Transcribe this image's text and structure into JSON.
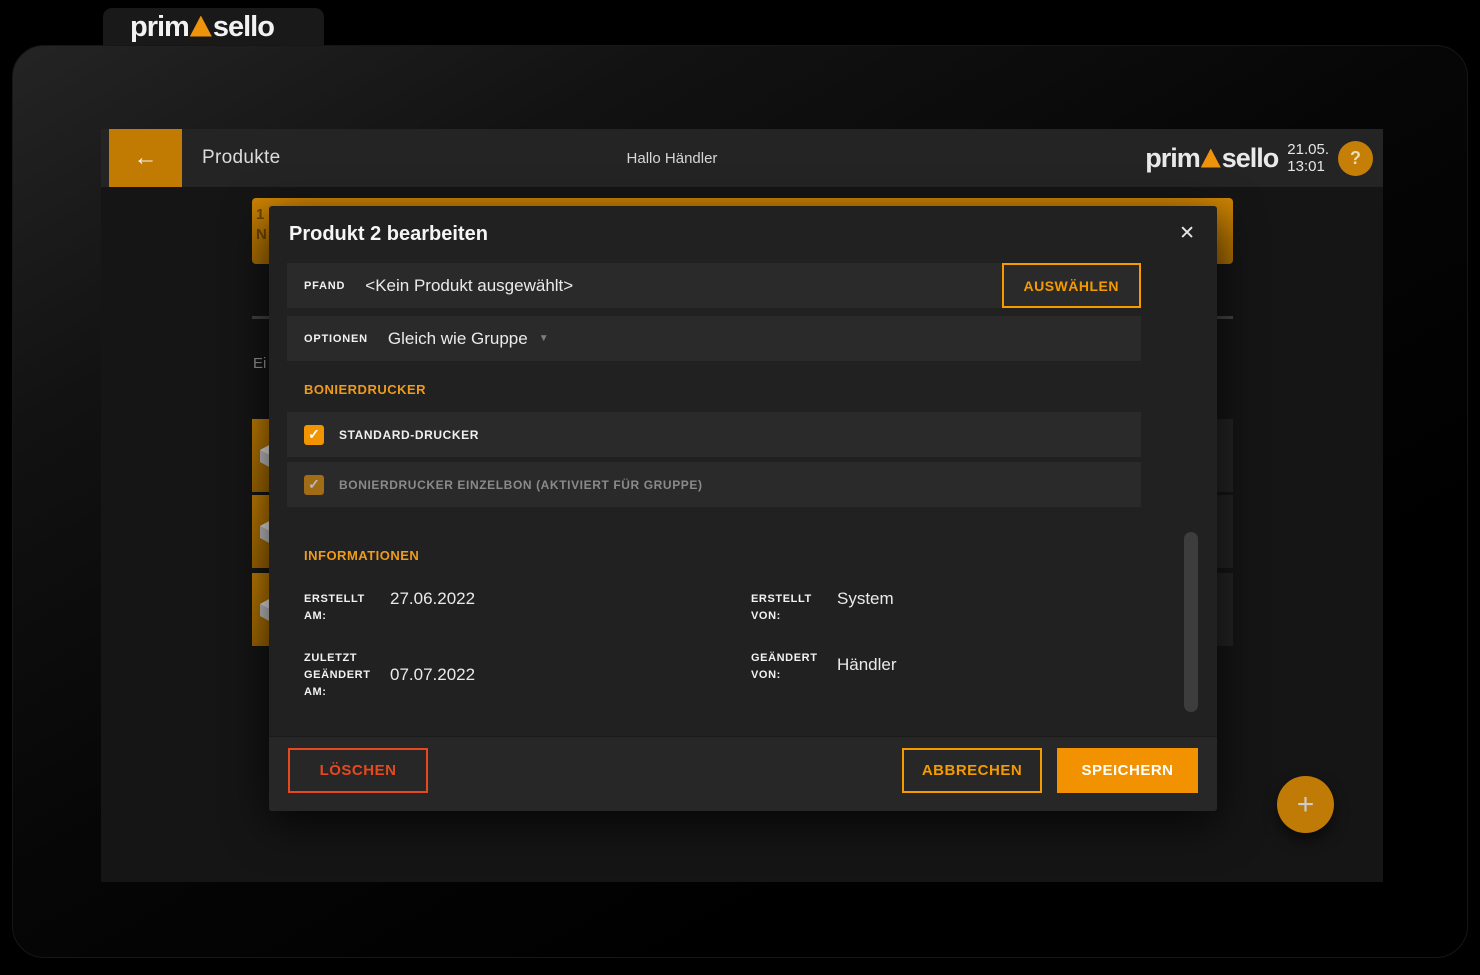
{
  "logo": {
    "prefix": "prim",
    "suffix": "sello"
  },
  "header": {
    "back_icon": "←",
    "title": "Produkte",
    "greeting": "Hallo Händler",
    "date": "21.05.",
    "time": "13:01",
    "help_label": "?"
  },
  "background_page": {
    "group_banner_fragment": "1\nN",
    "tab_fragment": "Ei",
    "product_row_count": 3
  },
  "modal": {
    "title": "Produkt 2 bearbeiten",
    "close_icon": "✕",
    "pfand": {
      "label": "PFAND",
      "value": "<Kein Produkt ausgewählt>",
      "button": "AUSWÄHLEN"
    },
    "optionen": {
      "label": "OPTIONEN",
      "value": "Gleich wie Gruppe",
      "caret_icon": "▼"
    },
    "bonierdrucker": {
      "title": "BONIERDRUCKER",
      "checkboxes": [
        {
          "label": "STANDARD-DRUCKER",
          "checked": true,
          "disabled": false,
          "check_icon": "✓"
        },
        {
          "label": "BONIERDRUCKER EINZELBON (AKTIVIERT FÜR GRUPPE)",
          "checked": true,
          "disabled": true,
          "check_icon": "✓"
        }
      ]
    },
    "informationen": {
      "title": "INFORMATIONEN",
      "items": [
        {
          "label": "ERSTELLT AM:",
          "value": "27.06.2022"
        },
        {
          "label": "ERSTELLT VON:",
          "value": "System"
        },
        {
          "label": "ZULETZT GEÄNDERT AM:",
          "value": "07.07.2022"
        },
        {
          "label": "GEÄNDERT VON:",
          "value": "Händler"
        }
      ]
    },
    "footer": {
      "delete": "LÖSCHEN",
      "cancel": "ABBRECHEN",
      "save": "SPEICHERN"
    }
  },
  "fab": {
    "icon": "+"
  },
  "colors": {
    "accent_bright": "#f39200",
    "accent_outline": "#f59b00",
    "accent_dark": "#c17a02",
    "danger": "#e8481e",
    "modal_bg": "#212121",
    "row_bg": "#2a2a2a",
    "screen_bg": "#151515"
  }
}
